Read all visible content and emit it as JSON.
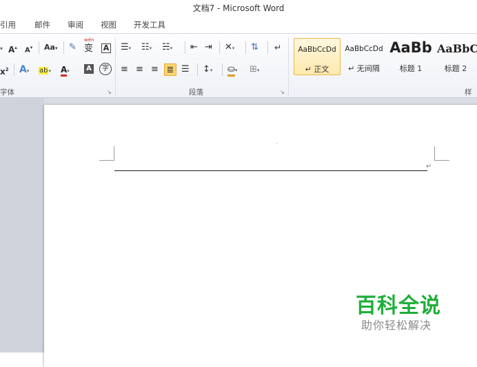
{
  "window": {
    "title": "文档7 - Microsoft Word"
  },
  "menu": {
    "tabs": [
      "引用",
      "邮件",
      "审阅",
      "视图",
      "开发工具"
    ]
  },
  "ribbon": {
    "font_group": {
      "label": "字体",
      "grow_font": "A",
      "shrink_font": "A",
      "change_case": "Aa",
      "phonetic": "wén",
      "phonetic_char": "变",
      "char_border": "A",
      "superscript": "x",
      "font_color": "A",
      "char_shading": "A",
      "enclose": "字"
    },
    "paragraph_group": {
      "label": "段落"
    },
    "styles_group": {
      "label": "样式",
      "tiles": [
        {
          "sample": "AaBbCcDd",
          "name": "↵ 正文"
        },
        {
          "sample": "AaBbCcDd",
          "name": "↵ 无间隔"
        },
        {
          "sample": "AaBb",
          "name": "标题 1"
        },
        {
          "sample": "AaBbC",
          "name": "标题 2"
        }
      ]
    }
  },
  "watermark": {
    "title": "百科全说",
    "subtitle": "助你轻松解决"
  },
  "colors": {
    "accent": "#1fae3b",
    "selected_tile": "#ffe9ad"
  }
}
